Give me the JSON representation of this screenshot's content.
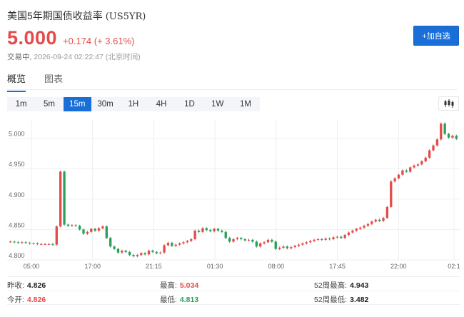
{
  "header": {
    "title": "美国5年期国债收益率",
    "code": "(US5YR)",
    "price": "5.000",
    "change": "+0.174 (+ 3.61%)",
    "status_label": "交易中,",
    "timestamp": "2026-09-24 02:22:47 (北京时间)",
    "add_button_label": "+加自选"
  },
  "tabs": [
    {
      "label": "概览",
      "active": true
    },
    {
      "label": "图表",
      "active": false
    }
  ],
  "periods": [
    {
      "label": "1m",
      "active": false
    },
    {
      "label": "5m",
      "active": false
    },
    {
      "label": "15m",
      "active": true
    },
    {
      "label": "30m",
      "active": false
    },
    {
      "label": "1H",
      "active": false
    },
    {
      "label": "4H",
      "active": false
    },
    {
      "label": "1D",
      "active": false
    },
    {
      "label": "1W",
      "active": false
    },
    {
      "label": "1M",
      "active": false
    }
  ],
  "stats": {
    "prev_close_label": "昨收:",
    "prev_close": "4.826",
    "high_label": "最高:",
    "high": "5.034",
    "wk52_high_label": "52周最高:",
    "wk52_high": "4.943",
    "open_label": "今开:",
    "open": "4.826",
    "low_label": "最低:",
    "low": "4.813",
    "wk52_low_label": "52周最低:",
    "wk52_low": "3.482"
  },
  "colors": {
    "up": "#e44c4c",
    "down": "#2aa05a",
    "accent": "#1a6ed8"
  },
  "chart_data": {
    "type": "candlestick",
    "ylim": [
      4.8,
      5.03
    ],
    "y_ticks": [
      "4.800",
      "4.850",
      "4.900",
      "4.950",
      "5.000"
    ],
    "x_ticks": [
      "05:00",
      "17:00",
      "21:15",
      "01:30",
      "08:00",
      "17:45",
      "22:00",
      "02:1"
    ],
    "grid": true,
    "closes": [
      4.83,
      4.829,
      4.828,
      4.829,
      4.828,
      4.827,
      4.827,
      4.826,
      4.826,
      4.826,
      4.826,
      4.825,
      4.855,
      4.945,
      4.858,
      4.856,
      4.857,
      4.856,
      4.85,
      4.843,
      4.846,
      4.851,
      4.848,
      4.852,
      4.855,
      4.836,
      4.822,
      4.818,
      4.812,
      4.815,
      4.813,
      4.808,
      4.806,
      4.808,
      4.811,
      4.809,
      4.815,
      4.813,
      4.811,
      4.812,
      4.824,
      4.828,
      4.823,
      4.825,
      4.827,
      4.829,
      4.831,
      4.834,
      4.848,
      4.846,
      4.852,
      4.849,
      4.847,
      4.851,
      4.848,
      4.846,
      4.836,
      4.83,
      4.834,
      4.836,
      4.834,
      4.832,
      4.833,
      4.83,
      4.822,
      4.827,
      4.829,
      4.833,
      4.83,
      4.818,
      4.82,
      4.822,
      4.819,
      4.821,
      4.823,
      4.825,
      4.827,
      4.829,
      4.831,
      4.833,
      4.834,
      4.833,
      4.835,
      4.834,
      4.837,
      4.838,
      4.836,
      4.841,
      4.845,
      4.848,
      4.851,
      4.853,
      4.856,
      4.859,
      4.863,
      4.866,
      4.864,
      4.869,
      4.887,
      4.929,
      4.934,
      4.94,
      4.947,
      4.945,
      4.952,
      4.955,
      4.957,
      4.962,
      4.968,
      4.98,
      4.988,
      4.998,
      5.024,
      5.007,
      5.001,
      5.004,
      4.999
    ]
  }
}
